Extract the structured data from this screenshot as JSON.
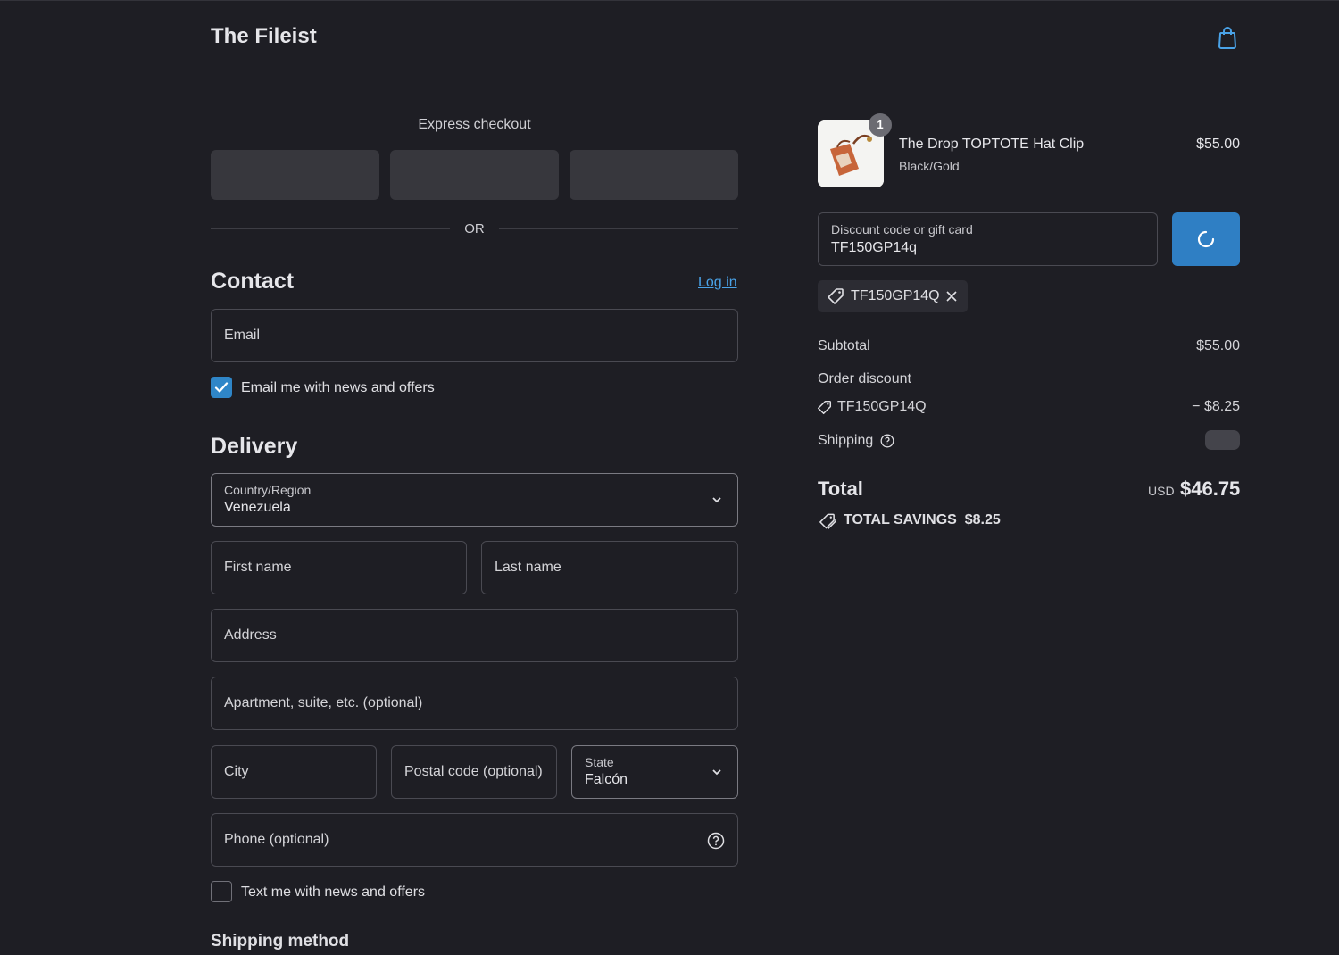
{
  "header": {
    "brand": "The Fileist",
    "cart_icon": "shopping-bag-icon"
  },
  "express": {
    "title": "Express checkout",
    "or": "OR"
  },
  "contact": {
    "heading": "Contact",
    "login": "Log in",
    "email_placeholder": "Email",
    "news_checkbox_label": "Email me with news and offers",
    "news_checked": true
  },
  "delivery": {
    "heading": "Delivery",
    "country_label": "Country/Region",
    "country_value": "Venezuela",
    "first_name": "First name",
    "last_name": "Last name",
    "address": "Address",
    "apartment": "Apartment, suite, etc. (optional)",
    "city": "City",
    "postal": "Postal code (optional)",
    "state_label": "State",
    "state_value": "Falcón",
    "phone": "Phone (optional)",
    "sms_checkbox_label": "Text me with news and offers",
    "sms_checked": false
  },
  "shipping_method": {
    "heading": "Shipping method"
  },
  "summary": {
    "product": {
      "quantity": "1",
      "name": "The Drop TOPTOTE Hat Clip",
      "variant": "Black/Gold",
      "price": "$55.00"
    },
    "discount_field": {
      "label": "Discount code or gift card",
      "value": "TF150GP14q"
    },
    "applied_code": "TF150GP14Q",
    "subtotal_label": "Subtotal",
    "subtotal_value": "$55.00",
    "order_discount_label": "Order discount",
    "discount_code": "TF150GP14Q",
    "discount_value": "− $8.25",
    "shipping_label": "Shipping",
    "total_label": "Total",
    "currency": "USD",
    "total_value": "$46.75",
    "savings": "TOTAL SAVINGS  $8.25"
  },
  "colors": {
    "accent": "#2f7fc4",
    "link": "#4aa3e8",
    "background": "#1e1e24"
  }
}
